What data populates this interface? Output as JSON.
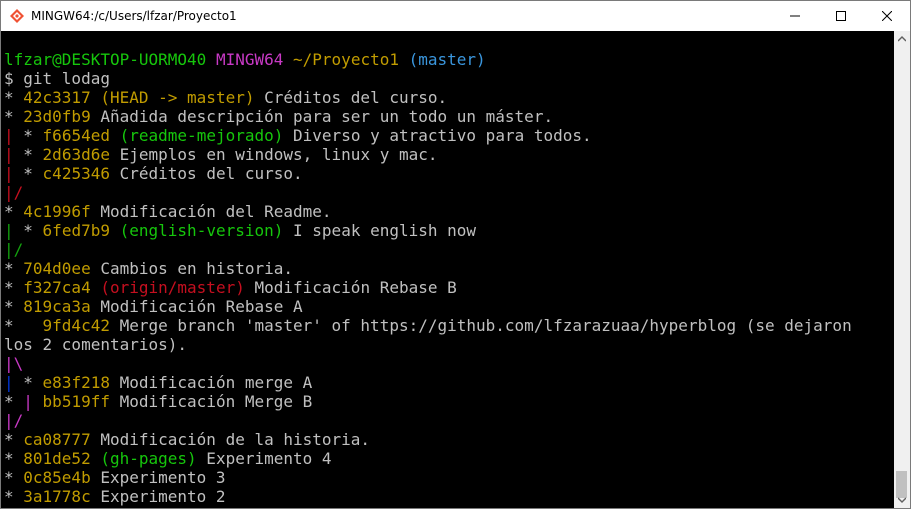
{
  "window": {
    "title": "MINGW64:/c/Users/lfzar/Proyecto1",
    "minimize_glyph": "—",
    "maximize_glyph": "☐",
    "close_glyph": "✕"
  },
  "colors": {
    "default": "#c0c0c0",
    "green": "#16c60c",
    "lightgreen": "#13a10e",
    "magenta": "#c839c5",
    "yellow": "#c19c00",
    "cyan": "#3a96dd",
    "red": "#c50f1f",
    "blue": "#0037da"
  },
  "terminal": {
    "lines": [
      [
        {
          "t": "lfzar@DESKTOP-UORMO40",
          "c": "#16c60c"
        },
        {
          "t": " "
        },
        {
          "t": "MINGW64",
          "c": "#c839c5"
        },
        {
          "t": " "
        },
        {
          "t": "~/Proyecto1",
          "c": "#c19c00"
        },
        {
          "t": " "
        },
        {
          "t": "(master)",
          "c": "#3a96dd"
        }
      ],
      [
        {
          "t": "$ git lodag"
        }
      ],
      [
        {
          "t": "* "
        },
        {
          "t": "42c3317",
          "c": "#c19c00"
        },
        {
          "t": " "
        },
        {
          "t": "(HEAD -> master)",
          "c": "#c19c00"
        },
        {
          "t": " Créditos del curso."
        }
      ],
      [
        {
          "t": "* "
        },
        {
          "t": "23d0fb9",
          "c": "#c19c00"
        },
        {
          "t": " Añadida descripción para ser un todo un máster."
        }
      ],
      [
        {
          "t": "|",
          "c": "#c50f1f"
        },
        {
          "t": " * "
        },
        {
          "t": "f6654ed",
          "c": "#c19c00"
        },
        {
          "t": " "
        },
        {
          "t": "(readme-mejorado)",
          "c": "#16c60c"
        },
        {
          "t": " Diverso y atractivo para todos."
        }
      ],
      [
        {
          "t": "|",
          "c": "#c50f1f"
        },
        {
          "t": " * "
        },
        {
          "t": "2d63d6e",
          "c": "#c19c00"
        },
        {
          "t": " Ejemplos en windows, linux y mac."
        }
      ],
      [
        {
          "t": "|",
          "c": "#c50f1f"
        },
        {
          "t": " * "
        },
        {
          "t": "c425346",
          "c": "#c19c00"
        },
        {
          "t": " Créditos del curso."
        }
      ],
      [
        {
          "t": "|/",
          "c": "#c50f1f"
        }
      ],
      [
        {
          "t": "* "
        },
        {
          "t": "4c1996f",
          "c": "#c19c00"
        },
        {
          "t": " Modificación del Readme."
        }
      ],
      [
        {
          "t": "|",
          "c": "#13a10e"
        },
        {
          "t": " * "
        },
        {
          "t": "6fed7b9",
          "c": "#c19c00"
        },
        {
          "t": " "
        },
        {
          "t": "(english-version)",
          "c": "#16c60c"
        },
        {
          "t": " I speak english now"
        }
      ],
      [
        {
          "t": "|/",
          "c": "#13a10e"
        }
      ],
      [
        {
          "t": "* "
        },
        {
          "t": "704d0ee",
          "c": "#c19c00"
        },
        {
          "t": " Cambios en historia."
        }
      ],
      [
        {
          "t": "* "
        },
        {
          "t": "f327ca4",
          "c": "#c19c00"
        },
        {
          "t": " "
        },
        {
          "t": "(origin/master)",
          "c": "#c50f1f"
        },
        {
          "t": " Modificación Rebase B"
        }
      ],
      [
        {
          "t": "* "
        },
        {
          "t": "819ca3a",
          "c": "#c19c00"
        },
        {
          "t": " Modificación Rebase A"
        }
      ],
      [
        {
          "t": "*   "
        },
        {
          "t": "9fd4c42",
          "c": "#c19c00"
        },
        {
          "t": " Merge branch 'master' of https://github.com/lfzarazuaa/hyperblog (se dejaron"
        }
      ],
      [
        {
          "t": "los 2 comentarios)."
        }
      ],
      [
        {
          "t": "|\\",
          "c": "#c839c5"
        }
      ],
      [
        {
          "t": "|",
          "c": "#0037da"
        },
        {
          "t": " * "
        },
        {
          "t": "e83f218",
          "c": "#c19c00"
        },
        {
          "t": " Modificación merge A"
        }
      ],
      [
        {
          "t": "* "
        },
        {
          "t": "|",
          "c": "#c839c5"
        },
        {
          "t": " "
        },
        {
          "t": "bb519ff",
          "c": "#c19c00"
        },
        {
          "t": " Modificación Merge B"
        }
      ],
      [
        {
          "t": "|/",
          "c": "#c839c5"
        }
      ],
      [
        {
          "t": "* "
        },
        {
          "t": "ca08777",
          "c": "#c19c00"
        },
        {
          "t": " Modificación de la historia."
        }
      ],
      [
        {
          "t": "* "
        },
        {
          "t": "801de52",
          "c": "#c19c00"
        },
        {
          "t": " "
        },
        {
          "t": "(gh-pages)",
          "c": "#16c60c"
        },
        {
          "t": " Experimento 4"
        }
      ],
      [
        {
          "t": "* "
        },
        {
          "t": "0c85e4b",
          "c": "#c19c00"
        },
        {
          "t": " Experimento 3"
        }
      ],
      [
        {
          "t": "* "
        },
        {
          "t": "3a1778c",
          "c": "#c19c00"
        },
        {
          "t": " Experimento 2"
        }
      ]
    ]
  }
}
